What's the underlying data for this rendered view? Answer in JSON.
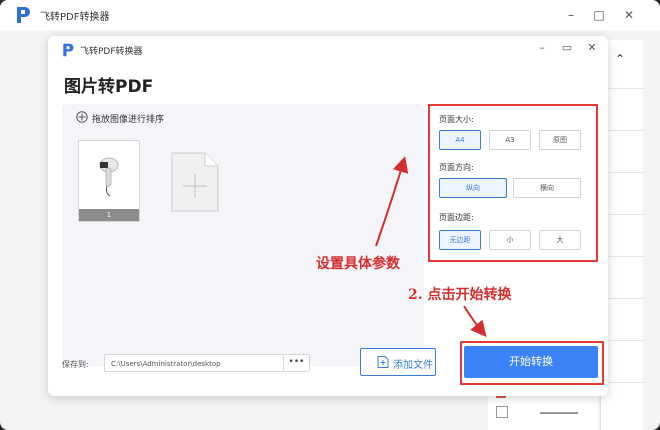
{
  "outer_window": {
    "title": "飞转PDF转换器"
  },
  "dialog": {
    "title": "飞转PDF转换器",
    "heading": "图片转PDF",
    "image_area": {
      "instruction": "拖放图像进行排序",
      "thumbnails": [
        {
          "number": "1"
        }
      ]
    },
    "settings": {
      "page_size": {
        "label": "页面大小:",
        "options": [
          "A4",
          "A3",
          "原图"
        ],
        "selected": "A4"
      },
      "orientation": {
        "label": "页面方向:",
        "options": [
          "纵向",
          "横向"
        ],
        "selected": "纵向"
      },
      "margin": {
        "label": "页面边距:",
        "options": [
          "无边距",
          "小",
          "大"
        ],
        "selected": "无边距"
      }
    },
    "save": {
      "label": "保存到:",
      "path": "C:\\Users\\Administrator\\desktop",
      "browse": "•••"
    },
    "add_file_button": "添加文件",
    "start_button": "开始转换"
  },
  "annotations": {
    "settings_note": "设置具体参数",
    "start_note": "2. 点击开始转换"
  },
  "colors": {
    "accent": "#3b82f6",
    "annotation": "#e53935"
  }
}
